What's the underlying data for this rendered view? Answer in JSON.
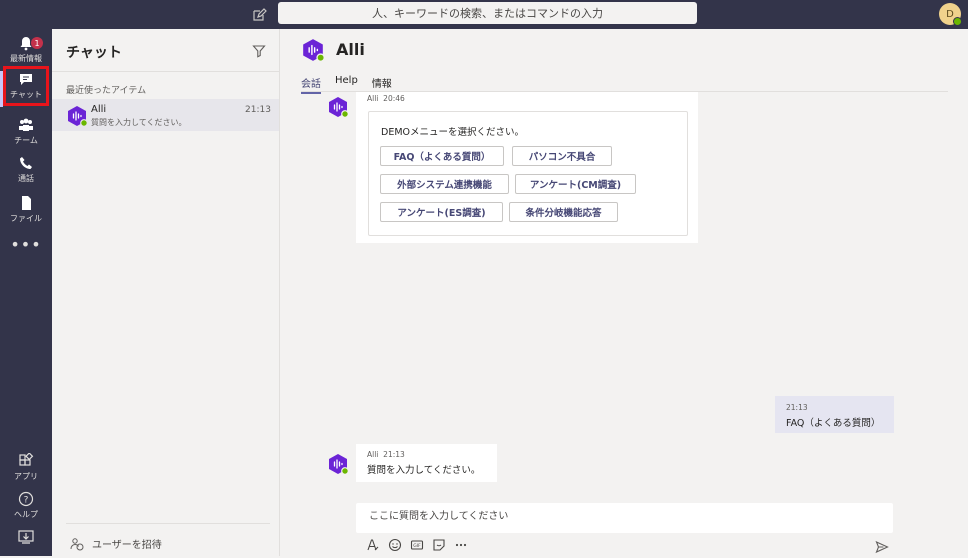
{
  "topbar": {
    "search_placeholder": "人、キーワードの検索、またはコマンドの入力",
    "avatar_initial": "D"
  },
  "rail": {
    "badge_count": "1",
    "items": [
      {
        "label": "最新情報",
        "icon": "bell-icon"
      },
      {
        "label": "チャット",
        "icon": "chat-icon"
      },
      {
        "label": "チーム",
        "icon": "teams-icon"
      },
      {
        "label": "通話",
        "icon": "phone-icon"
      },
      {
        "label": "ファイル",
        "icon": "file-icon"
      },
      {
        "label": "•••",
        "icon": "more-icon"
      },
      {
        "label": "アプリ",
        "icon": "apps-icon"
      },
      {
        "label": "ヘルプ",
        "icon": "help-icon"
      }
    ]
  },
  "chat_panel": {
    "title": "チャット",
    "recent_label": "最近使ったアイテム",
    "items": [
      {
        "name": "Alli",
        "preview": "質問を入力してください。",
        "time": "21:13"
      }
    ],
    "invite_label": "ユーザーを招待"
  },
  "conversation": {
    "title": "Alli",
    "tabs": [
      "会話",
      "Help",
      "情報"
    ],
    "messages": [
      {
        "sender": "Alli",
        "time": "20:46",
        "prompt": "DEMOメニューを選択ください。",
        "buttons": [
          "FAQ（よくある質問）",
          "パソコン不具合",
          "外部システム連携機能",
          "アンケート(CM調査)",
          "アンケート(ES調査)",
          "条件分岐機能応答"
        ]
      },
      {
        "sender": "",
        "time": "21:13",
        "text": "FAQ（よくある質問）"
      },
      {
        "sender": "Alli",
        "time": "21:13",
        "text": "質問を入力してください。"
      }
    ],
    "compose_placeholder": "ここに質問を入力してください"
  },
  "colors": {
    "rail": "#33344a",
    "accent": "#6264a7",
    "highlight": "#e8141b",
    "bot": "#6b24d6"
  }
}
